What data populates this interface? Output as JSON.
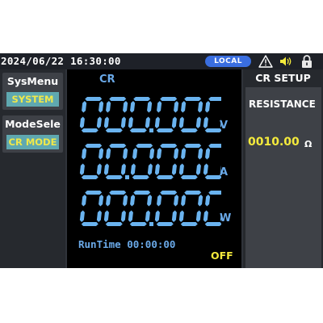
{
  "status": {
    "datetime": "2024/06/22 16:30:00",
    "control_mode": "LOCAL",
    "icons": [
      "warning-icon",
      "speaker-icon",
      "lock-icon"
    ]
  },
  "menu": {
    "sys": {
      "title": "SysMenu",
      "value": "SYSTEM"
    },
    "mode": {
      "title": "ModeSele",
      "value": "CR MODE"
    }
  },
  "main": {
    "mode_label": "CR",
    "readings": [
      {
        "value": "000.000",
        "unit": "V"
      },
      {
        "value": "00.0000",
        "unit": "A"
      },
      {
        "value": "000.000",
        "unit": "W"
      }
    ],
    "runtime_label": "RunTime",
    "runtime": "00:00:00",
    "output_state": "OFF"
  },
  "setup": {
    "header": "CR SETUP",
    "param_label": "RESISTANCE",
    "param_value": "0010.00",
    "param_unit": "Ω"
  },
  "colors": {
    "digit": "#6ab3ef",
    "accent_yellow": "#f4ea3c",
    "local_badge": "#3a6ee0",
    "menu_value_bg": "#5fa8b0"
  }
}
